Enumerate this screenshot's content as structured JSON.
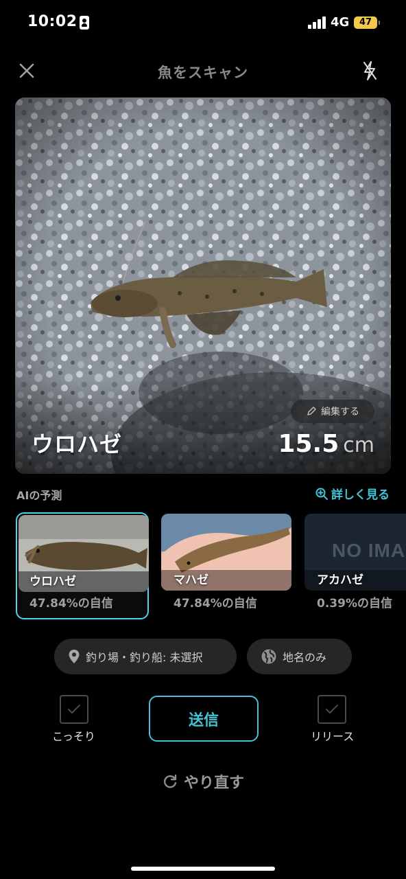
{
  "status_bar": {
    "time": "10:02",
    "network": "4G",
    "battery": "47"
  },
  "header": {
    "title": "魚をスキャン",
    "close_icon": "close-icon",
    "flash_icon": "flash-off-icon"
  },
  "photo": {
    "species": "ウロハゼ",
    "length_value": "15.5",
    "length_unit": "cm",
    "edit_label": "編集する"
  },
  "ai": {
    "label": "AIの予測",
    "details_label": "詳しく見る",
    "predictions": [
      {
        "name": "ウロハゼ",
        "confidence": "47.84%の自信",
        "selected": true
      },
      {
        "name": "マハゼ",
        "confidence": "47.84%の自信",
        "selected": false
      },
      {
        "name": "アカハゼ",
        "confidence": "0.39%の自信",
        "selected": false,
        "placeholder": "NO IMAGE"
      }
    ]
  },
  "location": {
    "spot_label": "釣り場・釣り船: 未選択",
    "region_label": "地名のみ"
  },
  "actions": {
    "secret_label": "こっそり",
    "send_label": "送信",
    "release_label": "リリース",
    "retry_label": "やり直す"
  },
  "colors": {
    "accent": "#45c3d6",
    "background": "#000000",
    "chip": "#262626"
  }
}
